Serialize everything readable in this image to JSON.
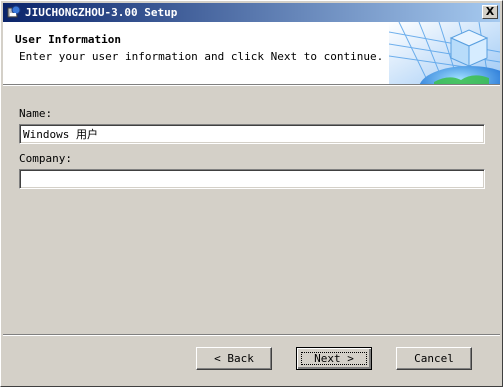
{
  "window": {
    "title": "JIUCHONGZHOU-3.00 Setup",
    "close_glyph": "X"
  },
  "header": {
    "title": "User Information",
    "subtitle": "Enter your user information and click Next to continue."
  },
  "form": {
    "name_label": "Name:",
    "name_value": "Windows 用户",
    "company_label": "Company:",
    "company_value": ""
  },
  "buttons": {
    "back": "< Back",
    "next": "Next >",
    "cancel": "Cancel"
  },
  "icons": {
    "app": "installer-icon",
    "header": "cube-globe-graphic"
  }
}
